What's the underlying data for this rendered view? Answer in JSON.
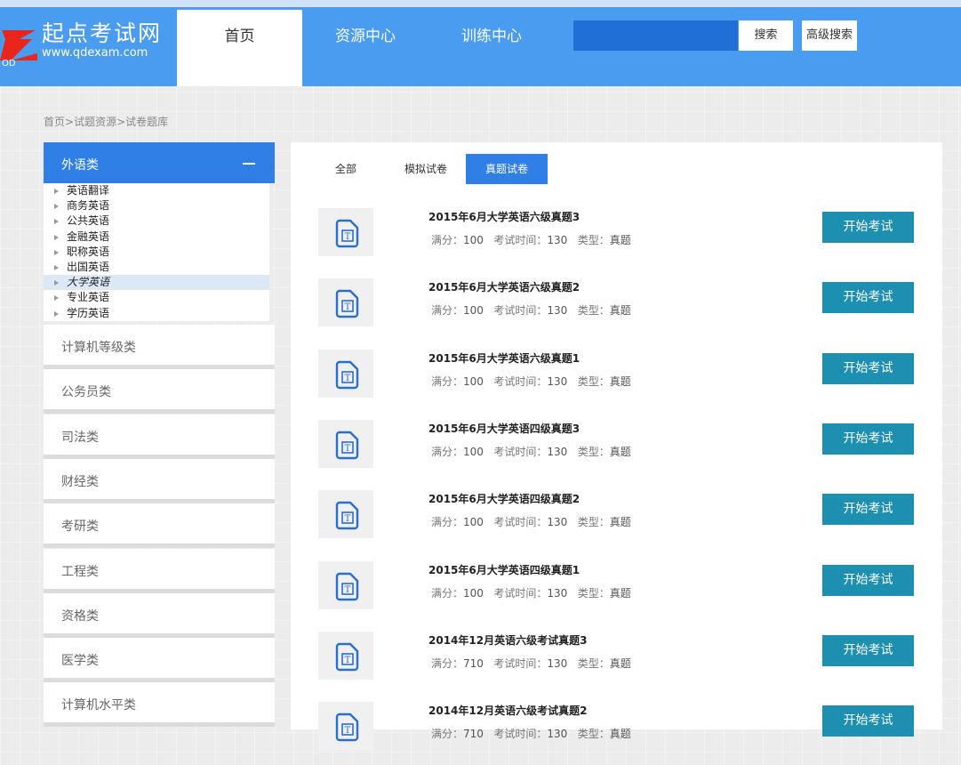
{
  "site": {
    "title": "起点考试网",
    "url": "www.qdexam.com"
  },
  "nav": {
    "items": [
      "首页",
      "资源中心",
      "训练中心"
    ]
  },
  "search": {
    "button": "搜索",
    "advanced": "高级搜索"
  },
  "breadcrumb": [
    "首页",
    ">",
    "试题资源",
    ">",
    "试卷题库"
  ],
  "sidebar": {
    "active_category": "外语类",
    "subcategories": [
      "英语翻译",
      "商务英语",
      "公共英语",
      "金融英语",
      "职称英语",
      "出国英语",
      "大学英语",
      "专业英语",
      "学历英语"
    ],
    "selected_subcategory": "大学英语",
    "categories": [
      "计算机等级类",
      "公务员类",
      "司法类",
      "财经类",
      "考研类",
      "工程类",
      "资格类",
      "医学类",
      "计算机水平类"
    ]
  },
  "tabs": [
    "全部",
    "模拟试卷",
    "真题试卷"
  ],
  "active_tab": "真题试卷",
  "meta_labels": {
    "score": "满分：",
    "time": "考试时间：",
    "type": "类型："
  },
  "start_label": "开始考试",
  "exams": [
    {
      "title": "2015年6月大学英语六级真题3",
      "score": "100",
      "time": "130",
      "type": "真题"
    },
    {
      "title": "2015年6月大学英语六级真题2",
      "score": "100",
      "time": "130",
      "type": "真题"
    },
    {
      "title": "2015年6月大学英语六级真题1",
      "score": "100",
      "time": "130",
      "type": "真题"
    },
    {
      "title": "2015年6月大学英语四级真题3",
      "score": "100",
      "time": "130",
      "type": "真题"
    },
    {
      "title": "2015年6月大学英语四级真题2",
      "score": "100",
      "time": "130",
      "type": "真题"
    },
    {
      "title": "2015年6月大学英语四级真题1",
      "score": "100",
      "time": "130",
      "type": "真题"
    },
    {
      "title": "2014年12月英语六级考试真题3",
      "score": "710",
      "time": "130",
      "type": "真题"
    },
    {
      "title": "2014年12月英语六级考试真题2",
      "score": "710",
      "time": "130",
      "type": "真题"
    }
  ],
  "colors": {
    "header": "#4a9cf0",
    "active_blue": "#2f7fe6",
    "start_button": "#1d8fb1",
    "icon_blue": "#2a6fc9"
  }
}
